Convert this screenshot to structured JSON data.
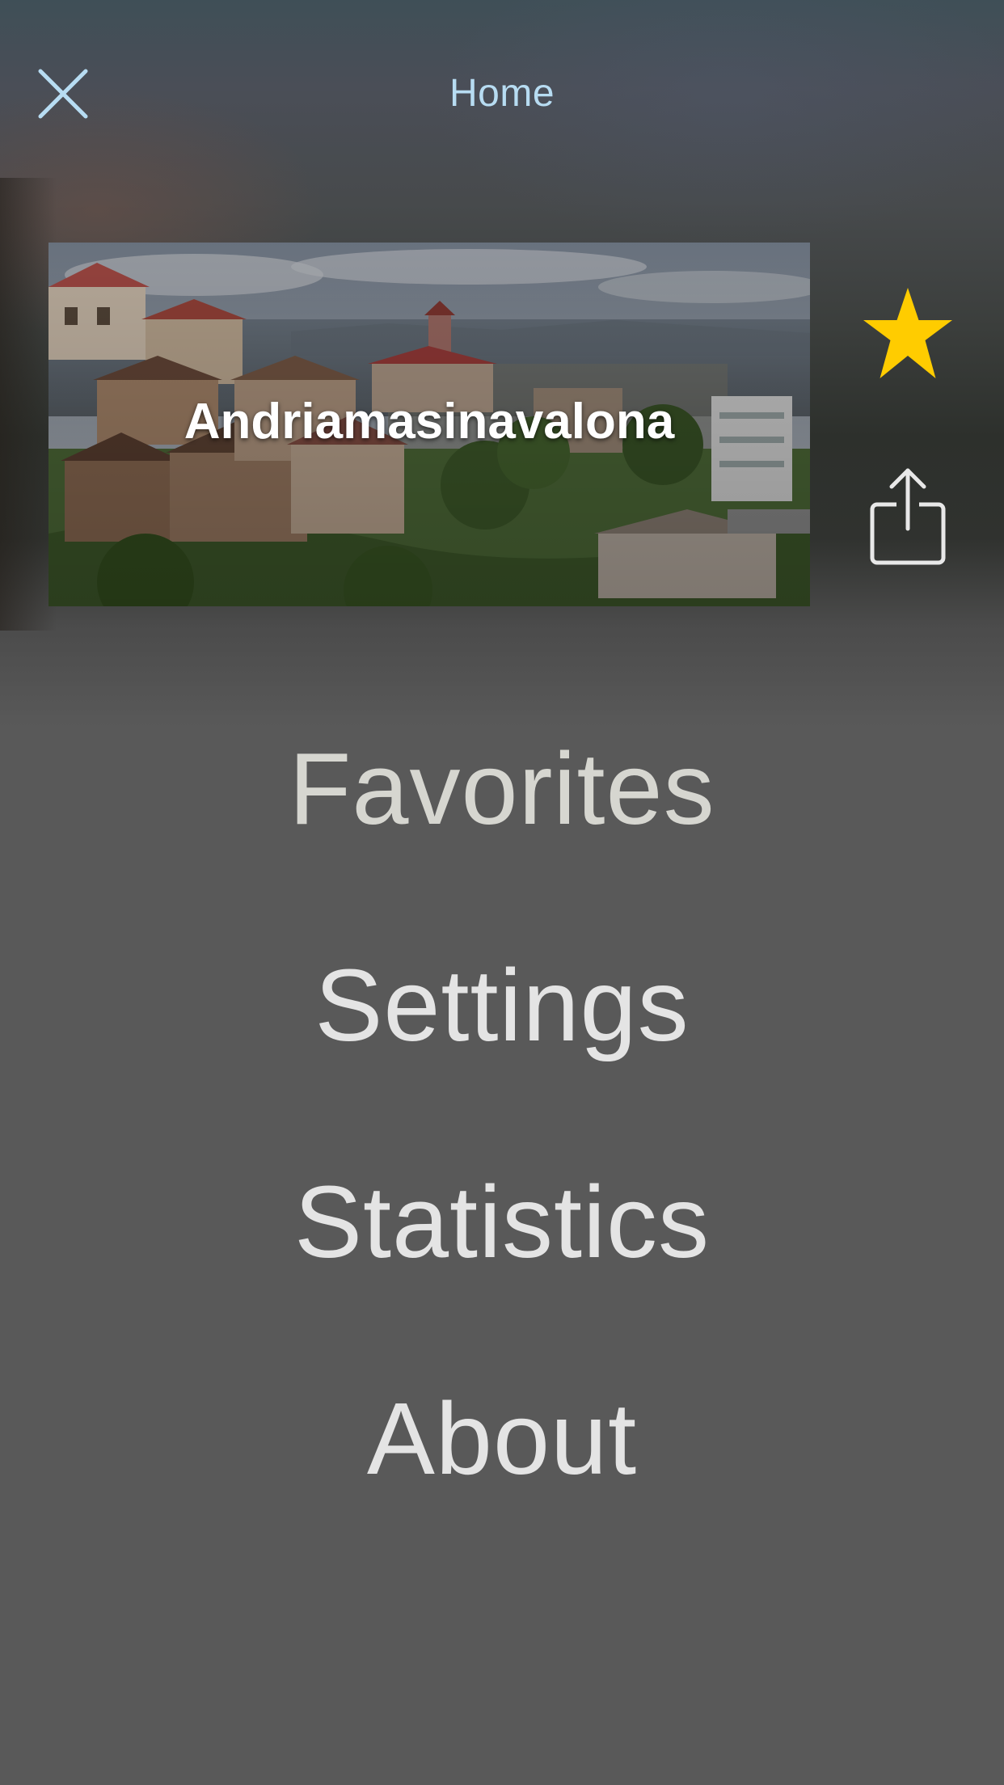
{
  "header": {
    "title": "Home",
    "close_icon": "close-icon"
  },
  "hero": {
    "title": "Andriamasinavalona",
    "image": "city-photo-madagascar-hillside"
  },
  "actions": {
    "favorite_icon": "star-icon",
    "favorite_color": "#FFCC00",
    "share_icon": "share-icon"
  },
  "menu": {
    "items": [
      {
        "label": "Favorites"
      },
      {
        "label": "Settings"
      },
      {
        "label": "Statistics"
      },
      {
        "label": "About"
      }
    ]
  },
  "colors": {
    "title_text": "#B7DCF2",
    "menu_text": "#E4E4E4",
    "background": "#595959"
  }
}
